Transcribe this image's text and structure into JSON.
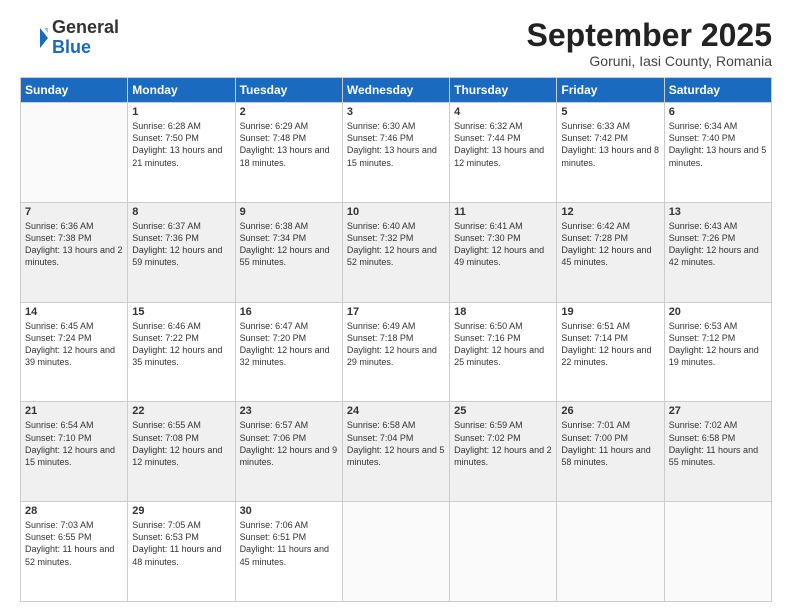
{
  "header": {
    "logo_general": "General",
    "logo_blue": "Blue",
    "month_title": "September 2025",
    "location": "Goruni, Iasi County, Romania"
  },
  "weekdays": [
    "Sunday",
    "Monday",
    "Tuesday",
    "Wednesday",
    "Thursday",
    "Friday",
    "Saturday"
  ],
  "weeks": [
    [
      {
        "day": "",
        "sunrise": "",
        "sunset": "",
        "daylight": ""
      },
      {
        "day": "1",
        "sunrise": "Sunrise: 6:28 AM",
        "sunset": "Sunset: 7:50 PM",
        "daylight": "Daylight: 13 hours and 21 minutes."
      },
      {
        "day": "2",
        "sunrise": "Sunrise: 6:29 AM",
        "sunset": "Sunset: 7:48 PM",
        "daylight": "Daylight: 13 hours and 18 minutes."
      },
      {
        "day": "3",
        "sunrise": "Sunrise: 6:30 AM",
        "sunset": "Sunset: 7:46 PM",
        "daylight": "Daylight: 13 hours and 15 minutes."
      },
      {
        "day": "4",
        "sunrise": "Sunrise: 6:32 AM",
        "sunset": "Sunset: 7:44 PM",
        "daylight": "Daylight: 13 hours and 12 minutes."
      },
      {
        "day": "5",
        "sunrise": "Sunrise: 6:33 AM",
        "sunset": "Sunset: 7:42 PM",
        "daylight": "Daylight: 13 hours and 8 minutes."
      },
      {
        "day": "6",
        "sunrise": "Sunrise: 6:34 AM",
        "sunset": "Sunset: 7:40 PM",
        "daylight": "Daylight: 13 hours and 5 minutes."
      }
    ],
    [
      {
        "day": "7",
        "sunrise": "Sunrise: 6:36 AM",
        "sunset": "Sunset: 7:38 PM",
        "daylight": "Daylight: 13 hours and 2 minutes."
      },
      {
        "day": "8",
        "sunrise": "Sunrise: 6:37 AM",
        "sunset": "Sunset: 7:36 PM",
        "daylight": "Daylight: 12 hours and 59 minutes."
      },
      {
        "day": "9",
        "sunrise": "Sunrise: 6:38 AM",
        "sunset": "Sunset: 7:34 PM",
        "daylight": "Daylight: 12 hours and 55 minutes."
      },
      {
        "day": "10",
        "sunrise": "Sunrise: 6:40 AM",
        "sunset": "Sunset: 7:32 PM",
        "daylight": "Daylight: 12 hours and 52 minutes."
      },
      {
        "day": "11",
        "sunrise": "Sunrise: 6:41 AM",
        "sunset": "Sunset: 7:30 PM",
        "daylight": "Daylight: 12 hours and 49 minutes."
      },
      {
        "day": "12",
        "sunrise": "Sunrise: 6:42 AM",
        "sunset": "Sunset: 7:28 PM",
        "daylight": "Daylight: 12 hours and 45 minutes."
      },
      {
        "day": "13",
        "sunrise": "Sunrise: 6:43 AM",
        "sunset": "Sunset: 7:26 PM",
        "daylight": "Daylight: 12 hours and 42 minutes."
      }
    ],
    [
      {
        "day": "14",
        "sunrise": "Sunrise: 6:45 AM",
        "sunset": "Sunset: 7:24 PM",
        "daylight": "Daylight: 12 hours and 39 minutes."
      },
      {
        "day": "15",
        "sunrise": "Sunrise: 6:46 AM",
        "sunset": "Sunset: 7:22 PM",
        "daylight": "Daylight: 12 hours and 35 minutes."
      },
      {
        "day": "16",
        "sunrise": "Sunrise: 6:47 AM",
        "sunset": "Sunset: 7:20 PM",
        "daylight": "Daylight: 12 hours and 32 minutes."
      },
      {
        "day": "17",
        "sunrise": "Sunrise: 6:49 AM",
        "sunset": "Sunset: 7:18 PM",
        "daylight": "Daylight: 12 hours and 29 minutes."
      },
      {
        "day": "18",
        "sunrise": "Sunrise: 6:50 AM",
        "sunset": "Sunset: 7:16 PM",
        "daylight": "Daylight: 12 hours and 25 minutes."
      },
      {
        "day": "19",
        "sunrise": "Sunrise: 6:51 AM",
        "sunset": "Sunset: 7:14 PM",
        "daylight": "Daylight: 12 hours and 22 minutes."
      },
      {
        "day": "20",
        "sunrise": "Sunrise: 6:53 AM",
        "sunset": "Sunset: 7:12 PM",
        "daylight": "Daylight: 12 hours and 19 minutes."
      }
    ],
    [
      {
        "day": "21",
        "sunrise": "Sunrise: 6:54 AM",
        "sunset": "Sunset: 7:10 PM",
        "daylight": "Daylight: 12 hours and 15 minutes."
      },
      {
        "day": "22",
        "sunrise": "Sunrise: 6:55 AM",
        "sunset": "Sunset: 7:08 PM",
        "daylight": "Daylight: 12 hours and 12 minutes."
      },
      {
        "day": "23",
        "sunrise": "Sunrise: 6:57 AM",
        "sunset": "Sunset: 7:06 PM",
        "daylight": "Daylight: 12 hours and 9 minutes."
      },
      {
        "day": "24",
        "sunrise": "Sunrise: 6:58 AM",
        "sunset": "Sunset: 7:04 PM",
        "daylight": "Daylight: 12 hours and 5 minutes."
      },
      {
        "day": "25",
        "sunrise": "Sunrise: 6:59 AM",
        "sunset": "Sunset: 7:02 PM",
        "daylight": "Daylight: 12 hours and 2 minutes."
      },
      {
        "day": "26",
        "sunrise": "Sunrise: 7:01 AM",
        "sunset": "Sunset: 7:00 PM",
        "daylight": "Daylight: 11 hours and 58 minutes."
      },
      {
        "day": "27",
        "sunrise": "Sunrise: 7:02 AM",
        "sunset": "Sunset: 6:58 PM",
        "daylight": "Daylight: 11 hours and 55 minutes."
      }
    ],
    [
      {
        "day": "28",
        "sunrise": "Sunrise: 7:03 AM",
        "sunset": "Sunset: 6:55 PM",
        "daylight": "Daylight: 11 hours and 52 minutes."
      },
      {
        "day": "29",
        "sunrise": "Sunrise: 7:05 AM",
        "sunset": "Sunset: 6:53 PM",
        "daylight": "Daylight: 11 hours and 48 minutes."
      },
      {
        "day": "30",
        "sunrise": "Sunrise: 7:06 AM",
        "sunset": "Sunset: 6:51 PM",
        "daylight": "Daylight: 11 hours and 45 minutes."
      },
      {
        "day": "",
        "sunrise": "",
        "sunset": "",
        "daylight": ""
      },
      {
        "day": "",
        "sunrise": "",
        "sunset": "",
        "daylight": ""
      },
      {
        "day": "",
        "sunrise": "",
        "sunset": "",
        "daylight": ""
      },
      {
        "day": "",
        "sunrise": "",
        "sunset": "",
        "daylight": ""
      }
    ]
  ]
}
